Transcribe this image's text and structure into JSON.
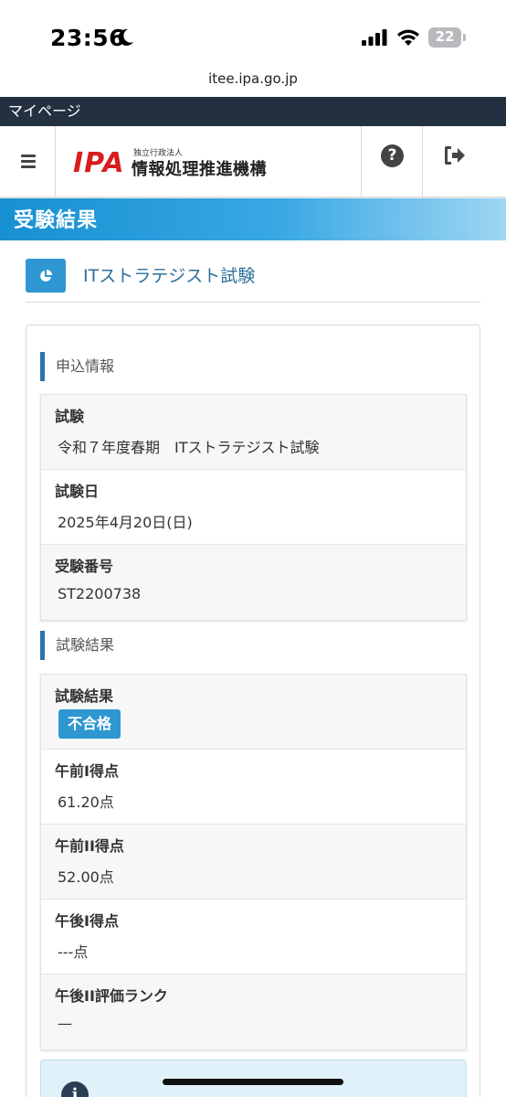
{
  "status_bar": {
    "time": "23:56",
    "battery": "22"
  },
  "url": "itee.ipa.go.jp",
  "top_bar": {
    "label": "マイページ"
  },
  "header": {
    "logo_mark": "IPA",
    "logo_small": "独立行政法人",
    "logo_name": "情報処理推進機構",
    "menu_icon": "hamburger-icon",
    "help_icon": "question-circle-icon",
    "logout_icon": "sign-out-icon"
  },
  "page_title": "受験結果",
  "exam_title": "ITストラテジスト試験",
  "application": {
    "heading": "申込情報",
    "rows": [
      {
        "label": "試験",
        "value": "令和７年度春期　ITストラテジスト試験"
      },
      {
        "label": "試験日",
        "value": "2025年4月20日(日)"
      },
      {
        "label": "受験番号",
        "value": "ST2200738"
      }
    ]
  },
  "results": {
    "heading": "試験結果",
    "status_label": "試験結果",
    "status_badge": "不合格",
    "rows": [
      {
        "label": "午前I得点",
        "value": "61.20点"
      },
      {
        "label": "午前II得点",
        "value": "52.00点"
      },
      {
        "label": "午後I得点",
        "value": "---点"
      },
      {
        "label": "午後II評価ランク",
        "value": "—"
      }
    ]
  },
  "colors": {
    "accent": "#2e97d1",
    "brand_red": "#d81e1e",
    "topbar": "#233040"
  }
}
